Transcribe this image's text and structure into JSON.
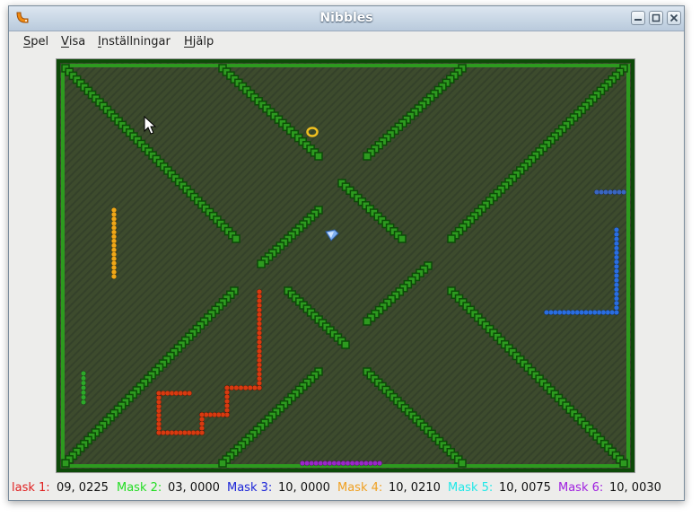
{
  "window": {
    "title": "Nibbles"
  },
  "menu": [
    {
      "key": "S",
      "rest": "pel"
    },
    {
      "key": "V",
      "rest": "isa"
    },
    {
      "key": "I",
      "rest": "nställningar"
    },
    {
      "key": "H",
      "rest": "jälp"
    }
  ],
  "scores": [
    {
      "label": "lask 1:",
      "value": "09, 0225",
      "color": "#e02020"
    },
    {
      "label": "Mask 2:",
      "value": "03, 0000",
      "color": "#22dd22"
    },
    {
      "label": "Mask 3:",
      "value": "10, 0000",
      "color": "#1a24d8"
    },
    {
      "label": "Mask 4:",
      "value": "10, 0210",
      "color": "#f0a020"
    },
    {
      "label": "Mask 5:",
      "value": "10, 0075",
      "color": "#20e8e8"
    },
    {
      "label": "Mask 6:",
      "value": "10, 0030",
      "color": "#a020e0"
    }
  ],
  "colors": {
    "board_bg": "#3b4a2b",
    "wall": "#2d9a1f",
    "wall_dark": "#0d4a08",
    "worm_red": "#d83a10",
    "worm_green": "#2ea82a",
    "worm_blue": "#2a6ee0",
    "worm_orange": "#f0a818",
    "worm_purple": "#9a28c8",
    "worm_darkblue": "#3a66c0"
  },
  "icons": {
    "app": "nibbles-worm-icon",
    "minimize": "minimize-icon",
    "maximize": "maximize-icon",
    "close": "close-icon",
    "cursor": "mouse-pointer-icon",
    "bonus_ring": "ring-bonus-icon",
    "bonus_diamond": "diamond-bonus-icon"
  }
}
